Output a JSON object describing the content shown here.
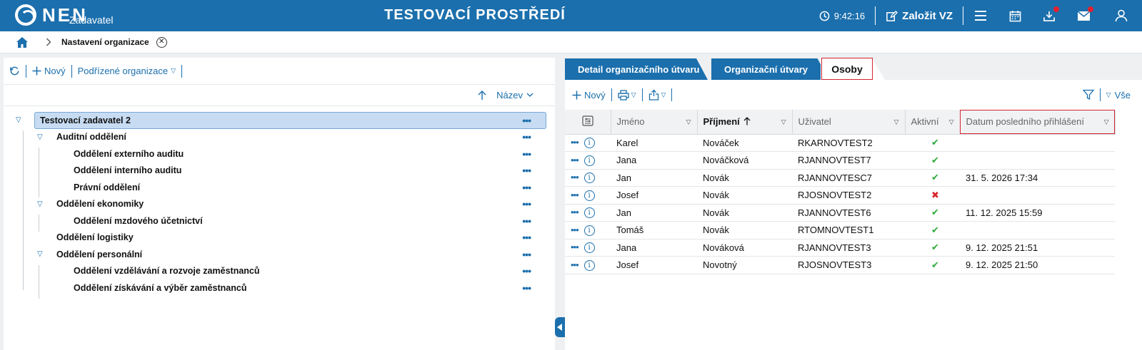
{
  "header": {
    "logo": "NEN",
    "logo_sub": "Zadavatel",
    "env_title": "TESTOVACÍ PROSTŘEDÍ",
    "clock": "9:42:16",
    "create_label": "Založit VZ",
    "icons": [
      "menu-icon",
      "calendar-icon",
      "download-icon",
      "mail-icon",
      "user-icon"
    ],
    "accent": "#1b6fad",
    "badge_color": "#e4202e"
  },
  "breadcrumb": {
    "current": "Nastavení organizace"
  },
  "left": {
    "toolbar": {
      "new_label": "Nový",
      "sub_org_label": "Podřízené organizace"
    },
    "sort_label": "Název",
    "tree": [
      {
        "label": "Testovací zadavatel 2",
        "level": 0,
        "toggle": true,
        "selected": true
      },
      {
        "label": "Auditní oddělení",
        "level": 1,
        "toggle": true
      },
      {
        "label": "Oddělení externího auditu",
        "level": 2
      },
      {
        "label": "Oddělení interního auditu",
        "level": 2
      },
      {
        "label": "Právní oddělení",
        "level": 2
      },
      {
        "label": "Oddělení ekonomiky",
        "level": 1,
        "toggle": true
      },
      {
        "label": "Oddělení mzdového účetnictví",
        "level": 2
      },
      {
        "label": "Oddělení logistiky",
        "level": 1
      },
      {
        "label": "Oddělení personální",
        "level": 1,
        "toggle": true
      },
      {
        "label": "Oddělení vzdělávání a rozvoje zaměstnanců",
        "level": 2
      },
      {
        "label": "Oddělení získávání a výběr zaměstnanců",
        "level": 2
      }
    ]
  },
  "right": {
    "tabs": [
      "Detail organizačního útvaru",
      "Organizační útvary",
      "Osoby"
    ],
    "toolbar": {
      "new_label": "Nový",
      "all_label": "Vše"
    },
    "columns": [
      "Jméno",
      "Příjmení",
      "Uživatel",
      "Aktivní",
      "Datum posledního přihlášení"
    ],
    "rows": [
      {
        "first": "Karel",
        "last": "Nováček",
        "user": "RKARNOVTEST2",
        "active": true,
        "last_login": ""
      },
      {
        "first": "Jana",
        "last": "Nováčková",
        "user": "RJANNOVTEST7",
        "active": true,
        "last_login": ""
      },
      {
        "first": "Jan",
        "last": "Novák",
        "user": "RJANNOVTESC7",
        "active": true,
        "last_login": "31. 5. 2026 17:34"
      },
      {
        "first": "Josef",
        "last": "Novák",
        "user": "RJOSNOVTEST2",
        "active": false,
        "last_login": ""
      },
      {
        "first": "Jan",
        "last": "Novák",
        "user": "RJANNOVTEST6",
        "active": true,
        "last_login": "11. 12. 2025 15:59"
      },
      {
        "first": "Tomáš",
        "last": "Novák",
        "user": "RTOMNOVTEST1",
        "active": true,
        "last_login": ""
      },
      {
        "first": "Jana",
        "last": "Nováková",
        "user": "RJANNOVTEST3",
        "active": true,
        "last_login": "9. 12. 2025 21:51"
      },
      {
        "first": "Josef",
        "last": "Novotný",
        "user": "RJOSNOVTEST3",
        "active": true,
        "last_login": "9. 12. 2025 21:50"
      }
    ]
  }
}
